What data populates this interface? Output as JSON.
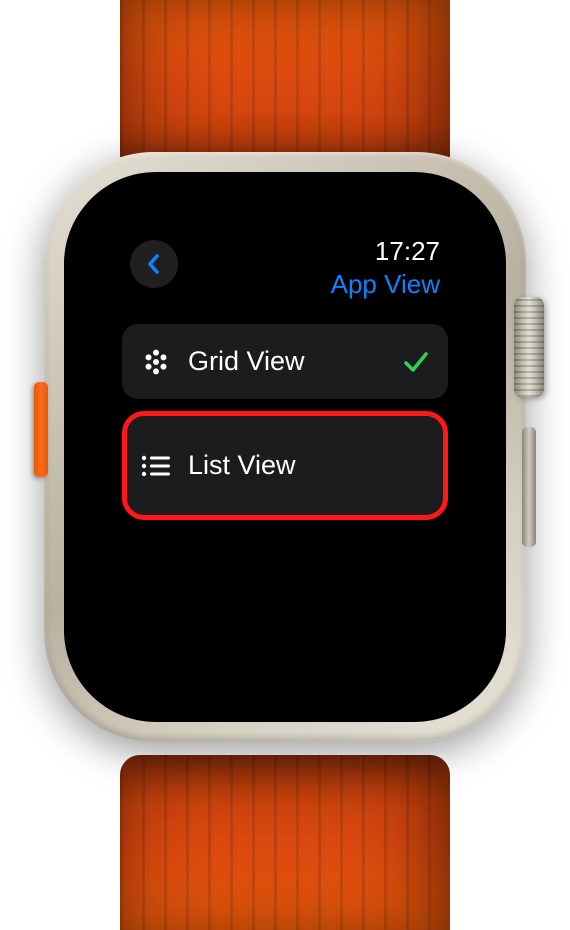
{
  "header": {
    "time": "17:27",
    "title": "App View"
  },
  "options": [
    {
      "label": "Grid View",
      "selected": true,
      "highlighted": false
    },
    {
      "label": "List View",
      "selected": false,
      "highlighted": true
    }
  ],
  "colors": {
    "accent_blue": "#0a84ff",
    "check_green": "#30d158",
    "highlight_red": "#ff1818",
    "band_orange": "#e8590c"
  }
}
